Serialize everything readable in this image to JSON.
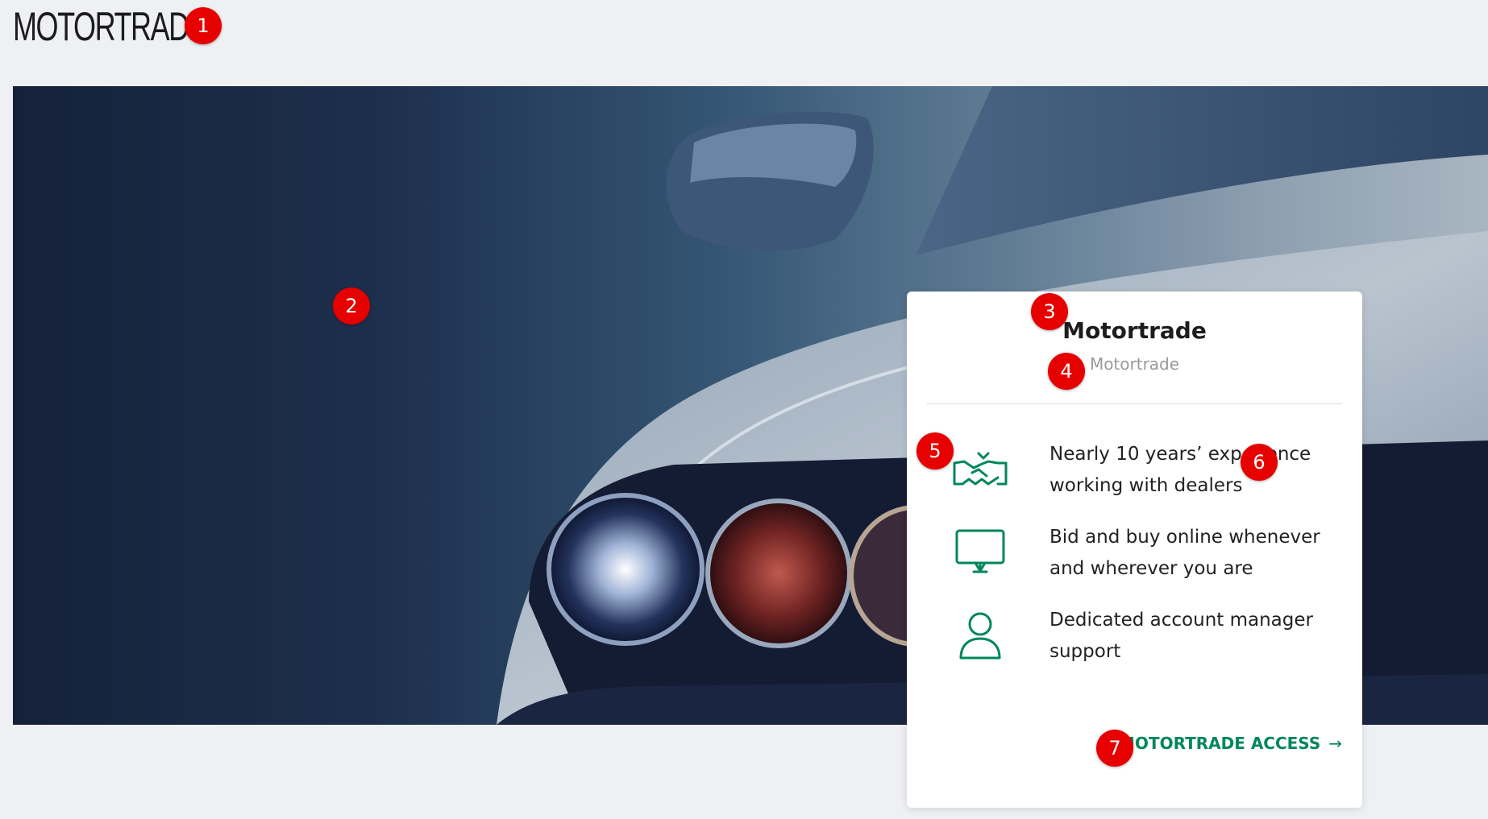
{
  "header": {
    "logo_text": "MOTORTRADE"
  },
  "hero": {
    "image": "car-headlights-photo"
  },
  "card": {
    "title": "Motortrade",
    "subtitle": "Motortrade",
    "features": [
      {
        "icon": "handshake-icon",
        "text": "Nearly 10 years’ experience working with dealers"
      },
      {
        "icon": "monitor-icon",
        "text": "Bid and buy online whenever and wherever you are"
      },
      {
        "icon": "user-icon",
        "text": "Dedicated account manager support"
      }
    ],
    "access_link": {
      "label": "MOTORTRADE ACCESS",
      "arrow": "→"
    }
  },
  "markers": [
    "1",
    "2",
    "3",
    "4",
    "5",
    "6",
    "7"
  ],
  "colors": {
    "accent": "#00875a",
    "marker": "#e60000",
    "page_background": "#eef0f4"
  }
}
